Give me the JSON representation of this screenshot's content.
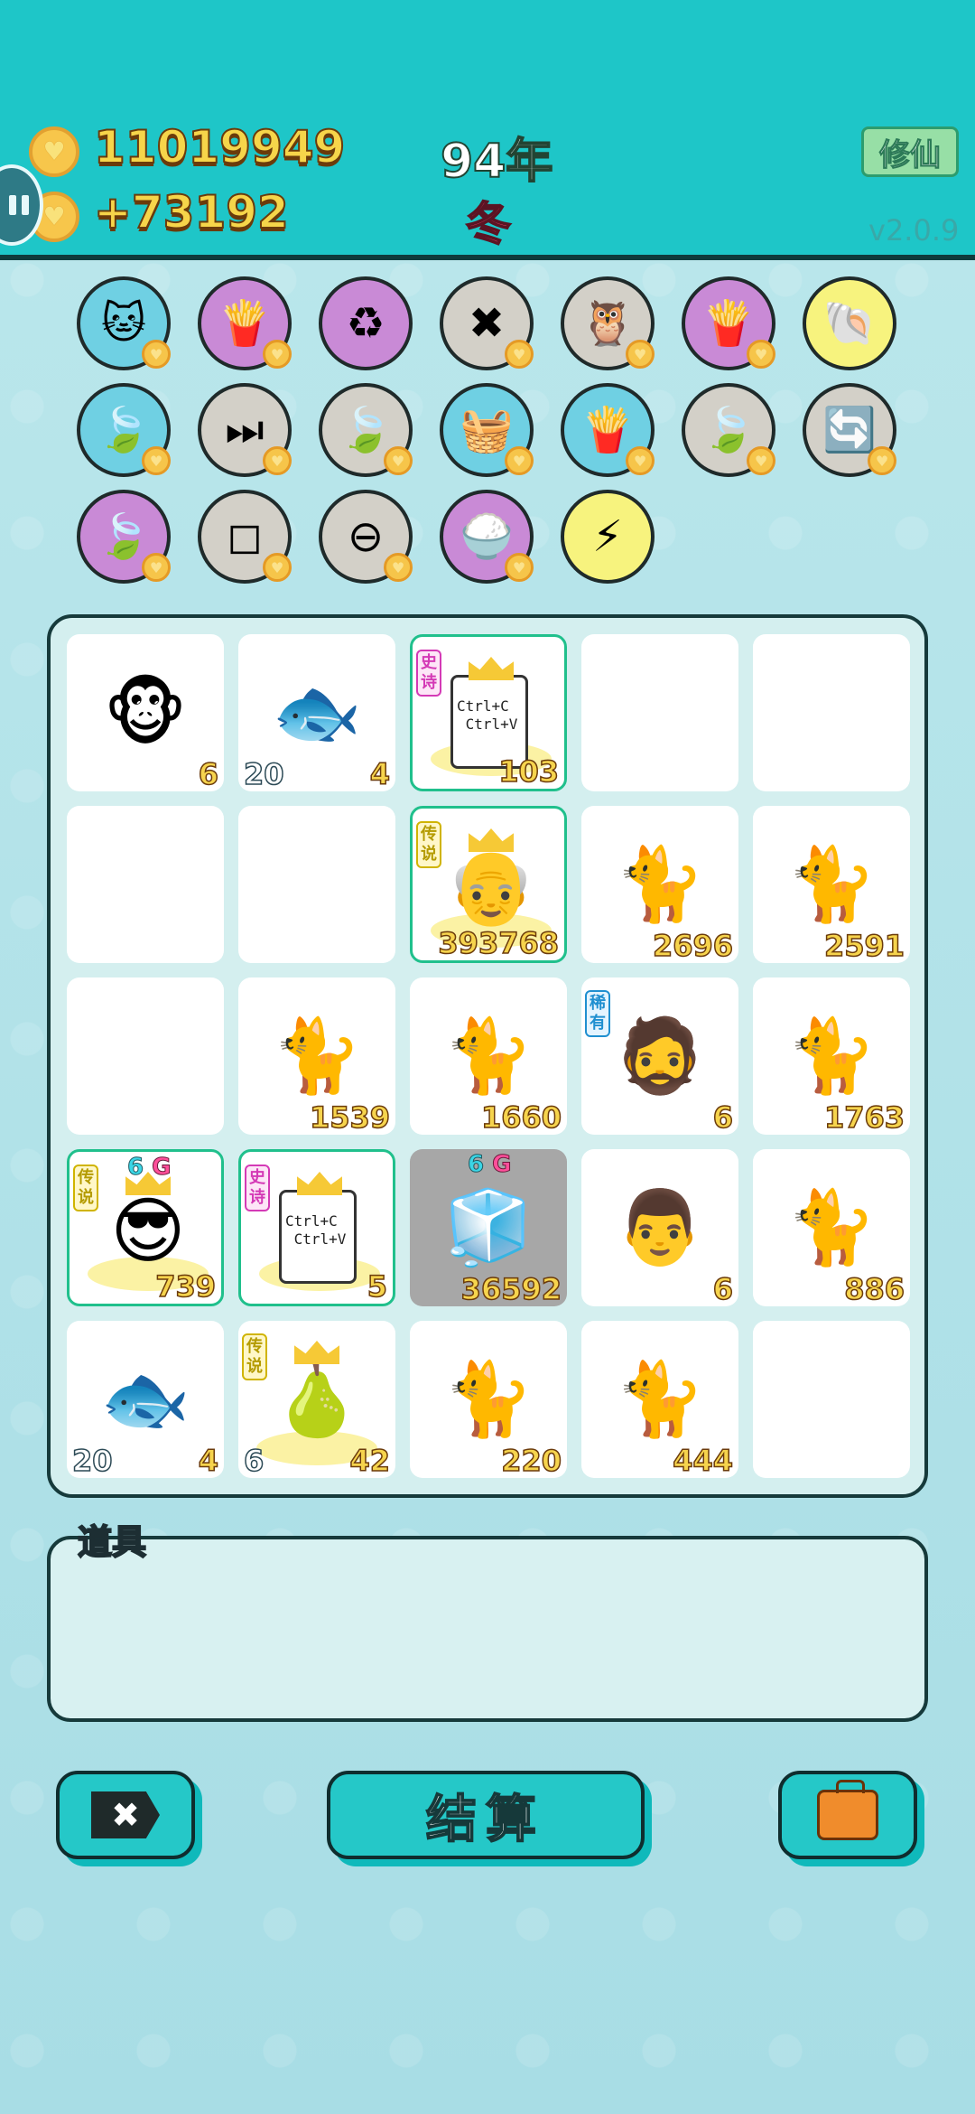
{
  "header": {
    "coins": "11019949",
    "coin_income": "+73192",
    "year": "94年",
    "season": "冬",
    "cultivate_label": "修仙",
    "version": "v2.0.9"
  },
  "items": [
    {
      "name": "cat-sunglasses-icon",
      "glyph": "🐱",
      "bg": "#6fd0e3",
      "heart": true
    },
    {
      "name": "fries-icon",
      "glyph": "🍟",
      "bg": "#c98ad6",
      "heart": true
    },
    {
      "name": "recycle-icon",
      "glyph": "♻",
      "bg": "#c98ad6",
      "heart": false
    },
    {
      "name": "delete-tag-icon",
      "glyph": "✖",
      "bg": "#d3d0c8",
      "heart": true
    },
    {
      "name": "owl-pair-icon",
      "glyph": "🦉",
      "bg": "#d3d0c8",
      "heart": true
    },
    {
      "name": "fries-icon",
      "glyph": "🍟",
      "bg": "#c98ad6",
      "heart": true
    },
    {
      "name": "shell-icon",
      "glyph": "🐚",
      "bg": "#f7f37e",
      "heart": false
    },
    {
      "name": "leaf-icon",
      "glyph": "🍃",
      "bg": "#6fd0e3",
      "heart": true
    },
    {
      "name": "skip-icon",
      "glyph": "⏭",
      "bg": "#d3d0c8",
      "heart": true
    },
    {
      "name": "leaf-icon",
      "glyph": "🍃",
      "bg": "#d3d0c8",
      "heart": true
    },
    {
      "name": "fruit-basket-icon",
      "glyph": "🧺",
      "bg": "#6fd0e3",
      "heart": true
    },
    {
      "name": "fries-icon",
      "glyph": "🍟",
      "bg": "#6fd0e3",
      "heart": true
    },
    {
      "name": "leaf-icon",
      "glyph": "🍃",
      "bg": "#d3d0c8",
      "heart": true
    },
    {
      "name": "refresh-icon",
      "glyph": "🔄",
      "bg": "#d3d0c8",
      "heart": true
    },
    {
      "name": "leaf-icon",
      "glyph": "🍃",
      "bg": "#c98ad6",
      "heart": true
    },
    {
      "name": "sugar-cubes-icon",
      "glyph": "◻",
      "bg": "#d3d0c8",
      "heart": true
    },
    {
      "name": "minus-circle-icon",
      "glyph": "⊖",
      "bg": "#d3d0c8",
      "heart": true
    },
    {
      "name": "rice-bowl-icon",
      "glyph": "🍚",
      "bg": "#c98ad6",
      "heart": true
    },
    {
      "name": "lightning-icon",
      "glyph": "⚡",
      "bg": "#f7f37e",
      "heart": false
    }
  ],
  "board": [
    {
      "name": "monkey-icon",
      "glyph": "🐵",
      "num_r": "6"
    },
    {
      "name": "fish-icon",
      "glyph": "🐟",
      "num_l": "20",
      "num_r": "4"
    },
    {
      "name": "ctrl-cv-card-icon",
      "special": true,
      "tag": "史诗",
      "tagc": "epic",
      "crown": true,
      "ctrl": true,
      "num_r": "103"
    },
    {
      "empty": true
    },
    {
      "empty": true
    },
    {
      "empty": true
    },
    {
      "empty": true
    },
    {
      "name": "grandpa-crown-icon",
      "glyph": "👴",
      "special": true,
      "tag": "传说",
      "tagc": "legend",
      "crown": true,
      "num_r": "393768"
    },
    {
      "name": "cat-icon",
      "glyph": "🐈",
      "num_r": "2696"
    },
    {
      "name": "cat-icon",
      "glyph": "🐈",
      "num_r": "2591"
    },
    {
      "empty": true
    },
    {
      "name": "cat-icon",
      "glyph": "🐈",
      "num_r": "1539"
    },
    {
      "name": "cat-icon",
      "glyph": "🐈",
      "num_r": "1660"
    },
    {
      "name": "bucket-hat-man-icon",
      "glyph": "🧔",
      "tag": "稀有",
      "tagc": "rare",
      "num_r": "6"
    },
    {
      "name": "cat-icon",
      "glyph": "🐈",
      "num_r": "1763"
    },
    {
      "name": "sunglasses-man-crown-icon",
      "glyph": "😎",
      "special": true,
      "tag": "传说",
      "tagc": "legend",
      "crown": true,
      "sixg": true,
      "num_r": "739"
    },
    {
      "name": "ctrl-cv-card-icon",
      "special": true,
      "tag": "史诗",
      "tagc": "epic",
      "crown": true,
      "ctrl": true,
      "num_r": "5"
    },
    {
      "name": "fridge-icon",
      "glyph": "🧊",
      "gray": true,
      "sixg": true,
      "num_r": "36592"
    },
    {
      "name": "old-man-glasses-icon",
      "glyph": "👨",
      "num_r": "6"
    },
    {
      "name": "cat-icon",
      "glyph": "🐈",
      "num_r": "886"
    },
    {
      "name": "fish-icon",
      "glyph": "🐟",
      "num_l": "20",
      "num_r": "4"
    },
    {
      "name": "pear-crown-icon",
      "glyph": "🍐",
      "tag": "传说",
      "tagc": "legend",
      "crown": true,
      "num_l": "6",
      "num_r": "42"
    },
    {
      "name": "cat-icon",
      "glyph": "🐈",
      "num_r": "220"
    },
    {
      "name": "cat-icon",
      "glyph": "🐈",
      "num_r": "444"
    },
    {
      "empty": true
    }
  ],
  "sixg": {
    "six": "6",
    "g": "G"
  },
  "ctrl_text": {
    "line1": "Ctrl+C",
    "line2": "Ctrl+V"
  },
  "props": {
    "label": "道具"
  },
  "buttons": {
    "delete_label": "✖",
    "settle_label": "结算"
  }
}
